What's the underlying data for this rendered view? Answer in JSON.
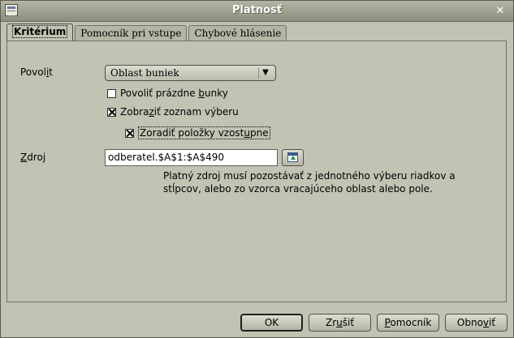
{
  "window": {
    "title": "Platnosť"
  },
  "tabs": [
    {
      "label": "Kritérium",
      "active": true
    },
    {
      "label": "Pomocník pri vstupe",
      "active": false
    },
    {
      "label": "Chybové hlásenie",
      "active": false
    }
  ],
  "criteria": {
    "allow_label_pre": "Povol",
    "allow_label_key": "i",
    "allow_label_post": "t",
    "allow_value": "Oblast buniek",
    "allow_blank": {
      "pre": "Povoliť prázdne ",
      "key": "b",
      "post": "unky",
      "checked": false
    },
    "show_list": {
      "pre": "Zobra",
      "key": "z",
      "post": "iť zoznam výberu",
      "checked": true
    },
    "sort_ascending": {
      "pre": "Zoradiť položky vzost",
      "key": "u",
      "post": "pne",
      "checked": true
    },
    "source_label_key": "Z",
    "source_label_post": "droj",
    "source_value": "odberatel.$A$1:$A$490",
    "hint": "Platný zdroj musí pozostávať z jednotného výberu riadkov a stĺpcov, alebo zo vzorca vracajúceho oblast alebo pole."
  },
  "buttons": {
    "ok": "OK",
    "cancel_pre": "Zr",
    "cancel_key": "u",
    "cancel_post": "šiť",
    "help_key": "P",
    "help_post": "omocník",
    "reset_pre": "Obno",
    "reset_key": "v",
    "reset_post": "iť"
  },
  "icons": {
    "window": "window-menu-icon",
    "close": "close-icon",
    "dropdown": "dropdown-arrow-icon",
    "shrink": "shrink-dialog-icon"
  }
}
